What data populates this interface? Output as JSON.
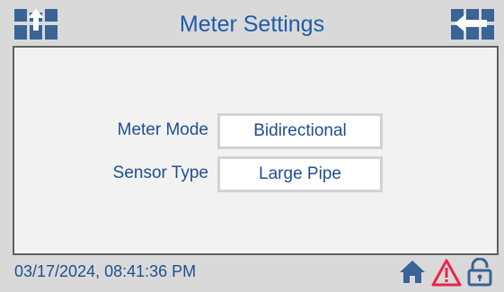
{
  "header": {
    "title": "Meter Settings",
    "left_icon": "upload-arrow-icon",
    "right_icon": "back-arrow-icon"
  },
  "settings": [
    {
      "label": "Meter Mode",
      "value": "Bidirectional"
    },
    {
      "label": "Sensor Type",
      "value": "Large Pipe"
    }
  ],
  "footer": {
    "datetime": "03/17/2024, 08:41:36 PM",
    "icons": [
      "home-icon",
      "warning-icon",
      "unlock-icon"
    ]
  },
  "colors": {
    "accent": "#1f5ca8",
    "text": "#1f4f8f",
    "icon": "#3a6396",
    "warning": "#e8264a",
    "panel": "#f2f2f2",
    "frame": "#d9d9d9"
  }
}
